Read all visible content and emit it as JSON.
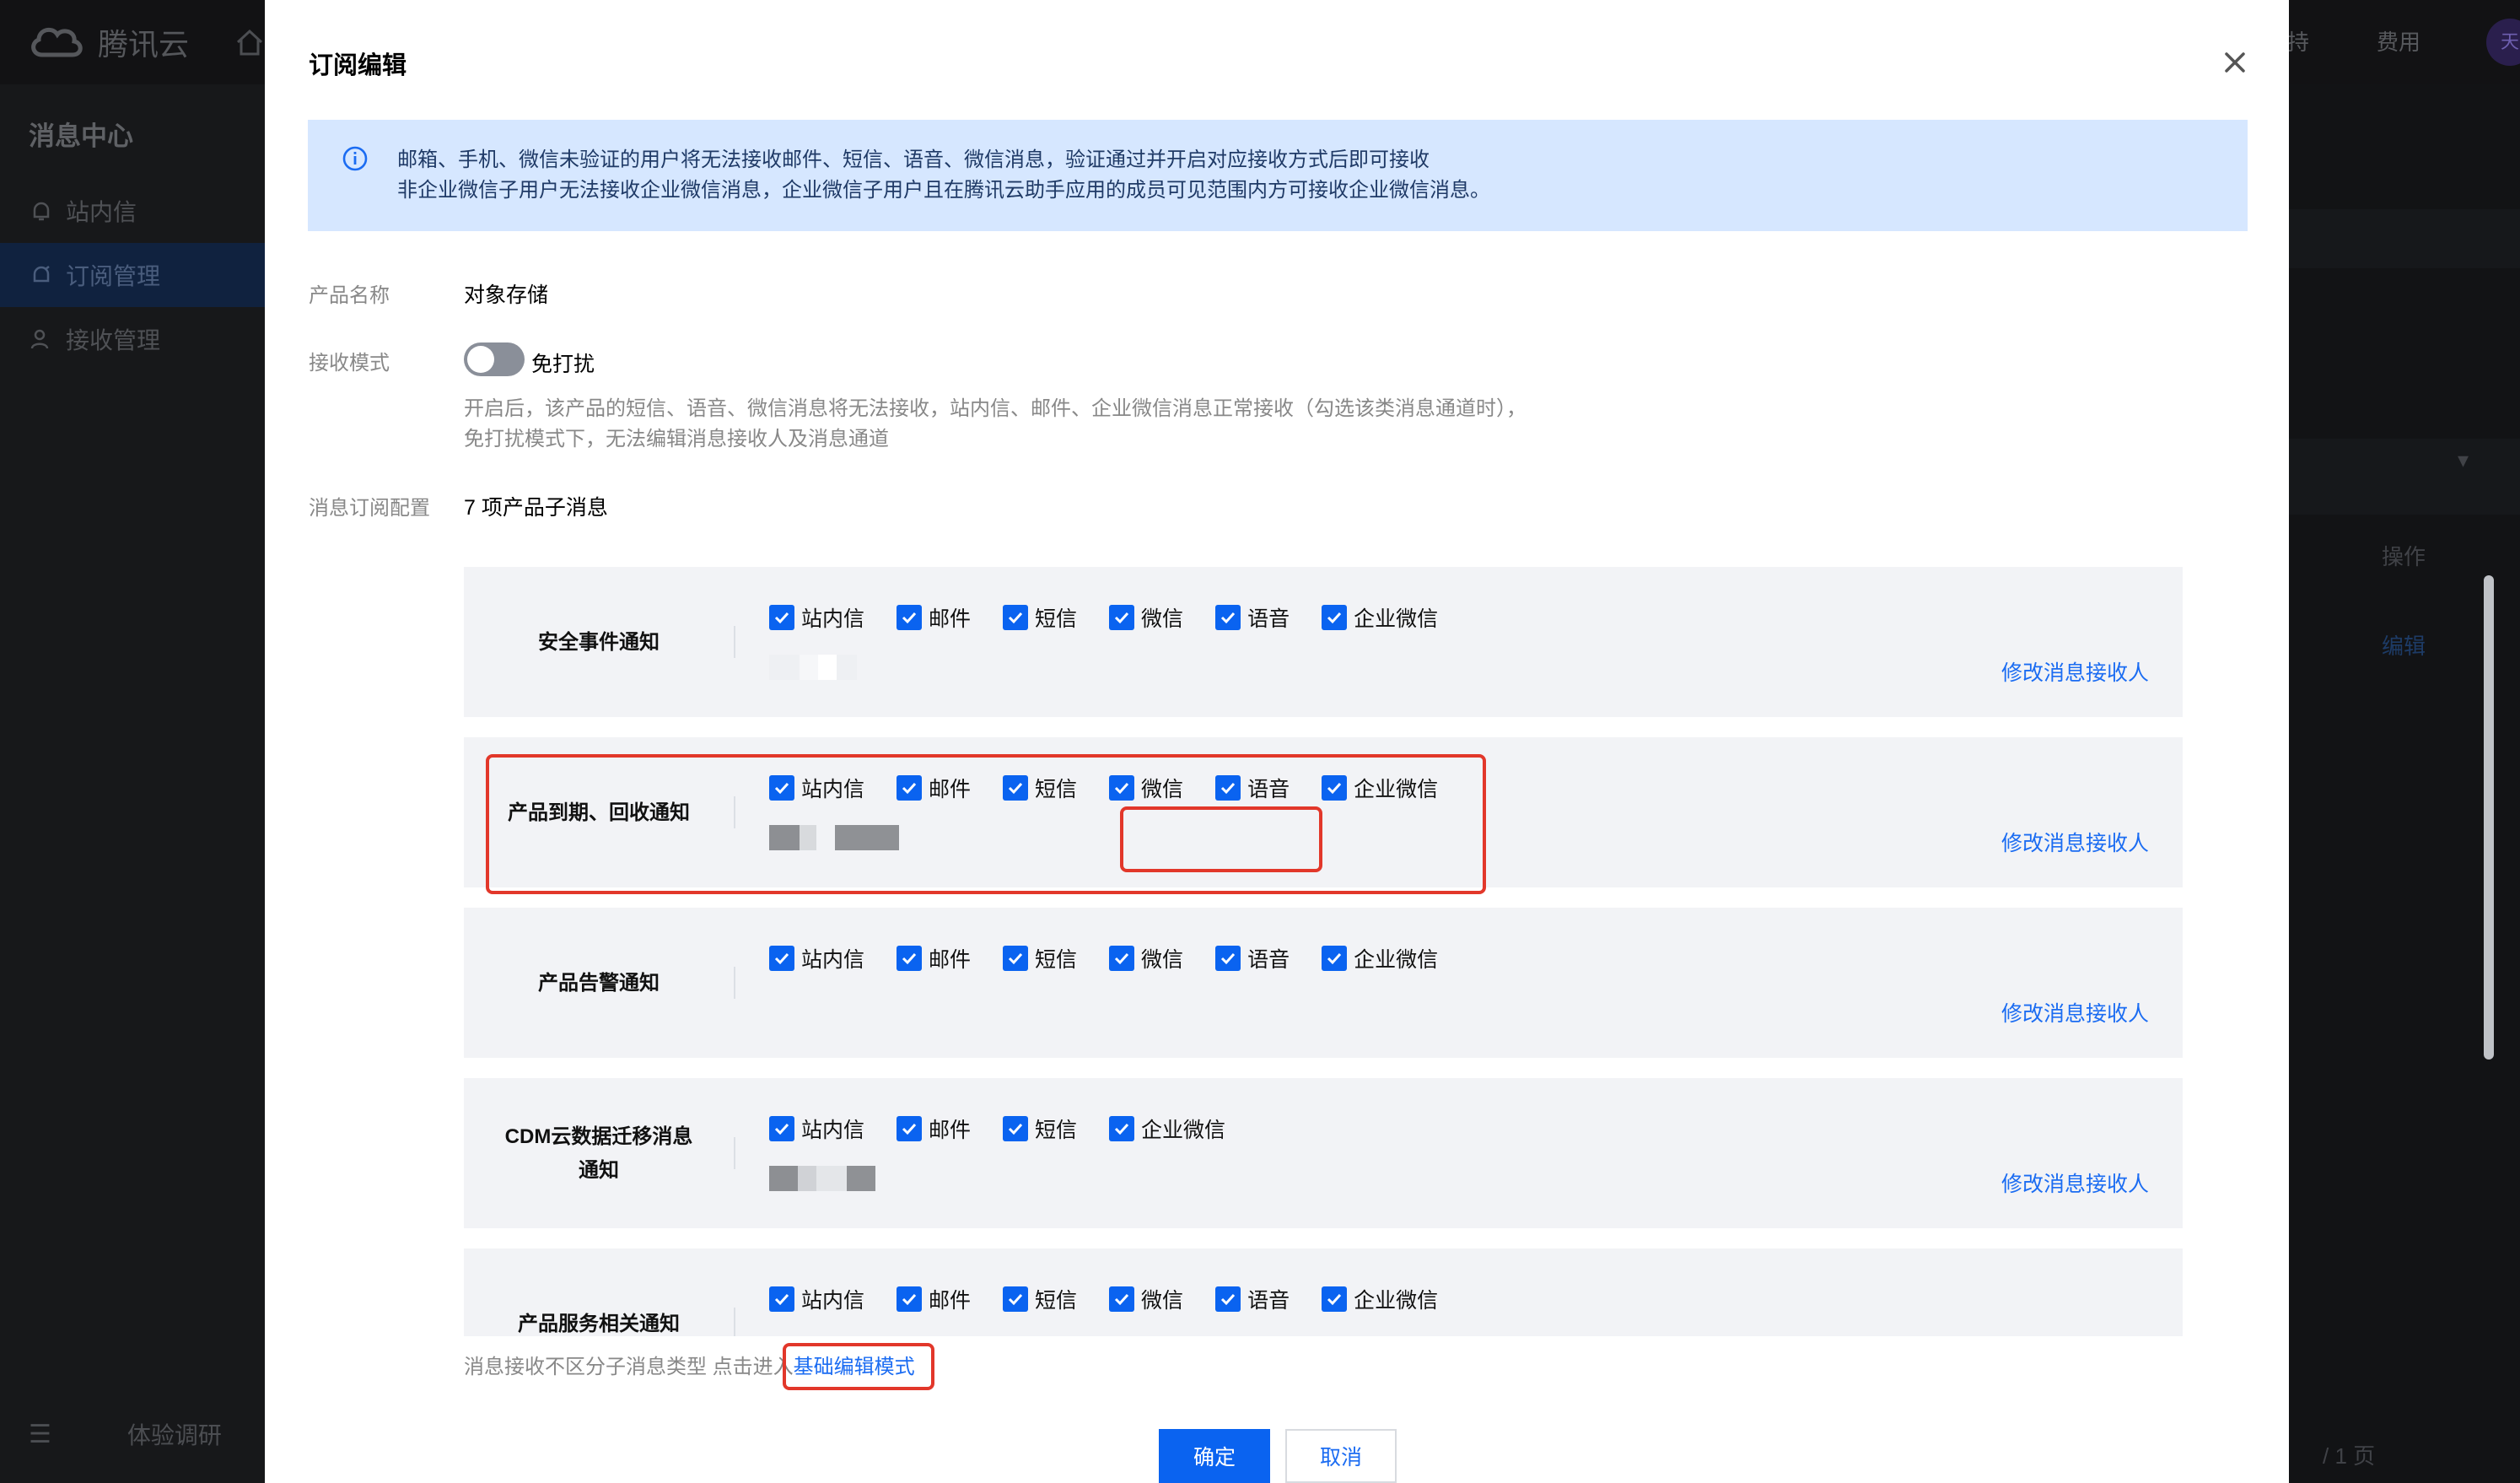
{
  "background": {
    "brand": "腾讯云",
    "topbar_right": [
      "持",
      "费用"
    ],
    "avatar_text": "天",
    "sidebar": {
      "title": "消息中心",
      "items": [
        {
          "label": "站内信",
          "icon": "bell-icon",
          "active": false
        },
        {
          "label": "订阅管理",
          "icon": "subscription-icon",
          "active": true
        },
        {
          "label": "接收管理",
          "icon": "users-icon",
          "active": false
        }
      ],
      "bottom_label": "体验调研"
    },
    "table_header_action": "操作",
    "row_action": "编辑",
    "pagination": "/ 1 页"
  },
  "modal": {
    "title": "订阅编辑",
    "alert_lines": [
      "邮箱、手机、微信未验证的用户将无法接收邮件、短信、语音、微信消息，验证通过并开启对应接收方式后即可接收",
      "非企业微信子用户无法接收企业微信消息，企业微信子用户且在腾讯云助手应用的成员可见范围内方可接收企业微信消息。"
    ],
    "product_label": "产品名称",
    "product_value": "对象存储",
    "mode_label": "接收模式",
    "mode_toggle_label": "免打扰",
    "mode_toggle_on": false,
    "mode_hint_lines": [
      "开启后，该产品的短信、语音、微信消息将无法接收，站内信、邮件、企业微信消息正常接收（勾选该类消息通道时），",
      "免打扰模式下，无法编辑消息接收人及消息通道"
    ],
    "config_label": "消息订阅配置",
    "config_value": "7 项产品子消息",
    "modify_label": "修改消息接收人",
    "messages": [
      {
        "title_lines": [
          "安全事件通知"
        ],
        "channels": [
          "站内信",
          "邮件",
          "短信",
          "微信",
          "语音",
          "企业微信"
        ],
        "recipients_redacted": true
      },
      {
        "title_lines": [
          "产品到期、回收通知"
        ],
        "channels": [
          "站内信",
          "邮件",
          "短信",
          "微信",
          "语音",
          "企业微信"
        ],
        "recipients_redacted": true
      },
      {
        "title_lines": [
          "产品告警通知"
        ],
        "channels": [
          "站内信",
          "邮件",
          "短信",
          "微信",
          "语音",
          "企业微信"
        ],
        "recipients_redacted": false
      },
      {
        "title_lines": [
          "CDM云数据迁移消息",
          "通知"
        ],
        "channels": [
          "站内信",
          "邮件",
          "短信",
          "企业微信"
        ],
        "recipients_redacted": true
      },
      {
        "title_lines": [
          "产品服务相关通知"
        ],
        "channels": [
          "站内信",
          "邮件",
          "短信",
          "微信",
          "语音",
          "企业微信"
        ],
        "recipients_redacted": false
      }
    ],
    "footnote_text": "消息接收不区分子消息类型 点击进入",
    "footnote_link": "基础编辑模式",
    "confirm_label": "确定",
    "cancel_label": "取消"
  },
  "colors": {
    "primary": "#0a63f0",
    "link": "#1b6cf2",
    "alert_bg": "#d6e7ff",
    "card_bg": "#f2f3f6",
    "highlight": "#e2372a"
  }
}
